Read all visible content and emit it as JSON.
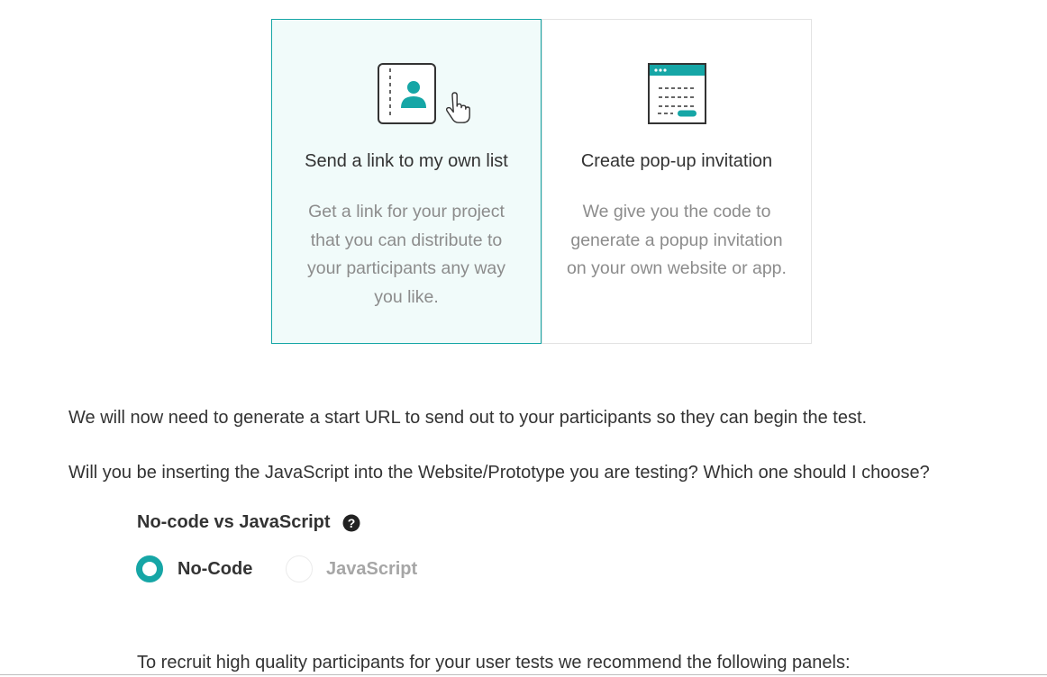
{
  "colors": {
    "accent": "#16a6a6",
    "selected_card_bg": "#f1fbfa",
    "muted_text": "#8c8c8c"
  },
  "options": [
    {
      "title": "Send a link to my own list",
      "description": "Get a link for your project that you can distribute to your participants any way you like.",
      "icon": "contact-book-icon",
      "selected": true
    },
    {
      "title": "Create pop-up invitation",
      "description": "We give you the code to generate a popup invitation on your own website or app.",
      "icon": "popup-window-icon",
      "selected": false
    }
  ],
  "intro_text": "We will now need to generate a start URL to send out to your participants so they can begin the test.",
  "question_text": "Will you be inserting the JavaScript into the Website/Prototype you are testing? Which one should I choose?",
  "mode": {
    "title": "No-code vs JavaScript",
    "help_icon": "question-circle-icon",
    "choices": [
      {
        "label": "No-Code",
        "checked": true
      },
      {
        "label": "JavaScript",
        "checked": false
      }
    ]
  },
  "recruit_text": "To recruit high quality participants for your user tests we recommend the following panels:"
}
